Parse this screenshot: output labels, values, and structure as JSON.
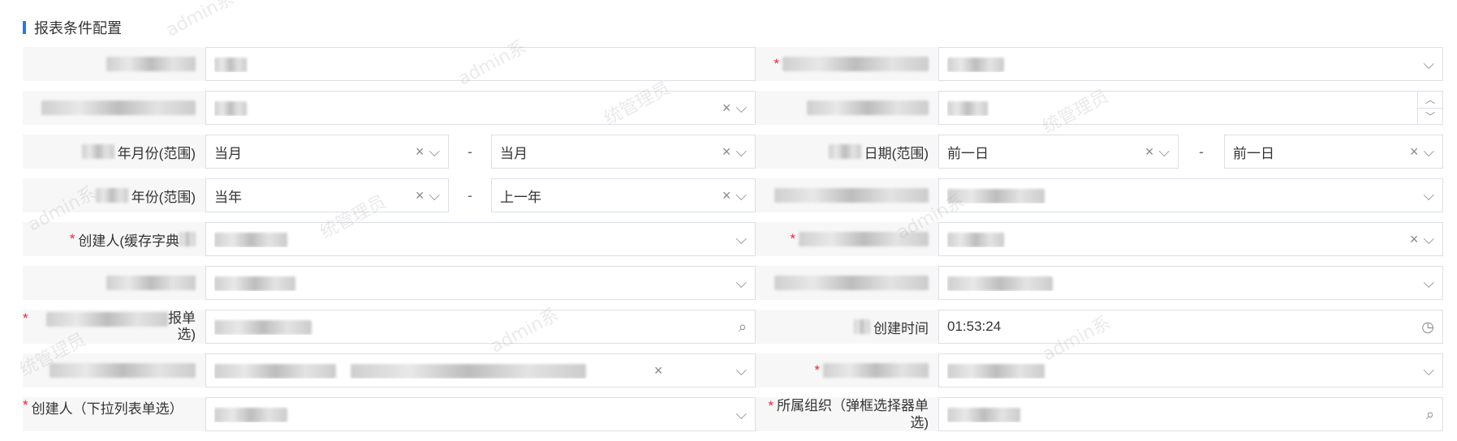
{
  "section": {
    "title": "报表条件配置"
  },
  "watermark": [
    "admin系",
    "统管理员"
  ],
  "rows": {
    "r1": {
      "right_required": "*"
    },
    "r2": {
      "left_label_prefix": "*字典状态(数据字典单选)",
      "right_label": "年份"
    },
    "r3": {
      "left_label": "年月份(范围)",
      "left_from": "当月",
      "left_to": "当月",
      "dash": "-",
      "right_label": "日期(范围)",
      "right_from": "前一日",
      "right_to": "前一日"
    },
    "r4": {
      "left_label": "年份(范围)",
      "left_from": "当年",
      "left_to": "上一年",
      "dash": "-"
    },
    "r5": {
      "left_label_prefix": "创建人(缓存字典",
      "left_required": "*",
      "right_required": "*"
    },
    "r7": {
      "left_required": "*",
      "left_label_tail": "选)",
      "left_label_tail2": "报单",
      "right_label": "创建时间",
      "right_value": "01:53:24"
    },
    "r8": {
      "right_required": "*"
    },
    "r9": {
      "left_required": "*",
      "left_label": "创建人（下拉列表单选）",
      "right_required": "*",
      "right_label": "所属组织（弹框选择器单",
      "right_label_tail": "选)"
    }
  },
  "icons": {
    "clear": "×",
    "chevron": "⌵",
    "search": "⌕",
    "clock": "◷",
    "up": "︿",
    "down": "﹀"
  },
  "colors": {
    "accent": "#1f7bf0",
    "required": "#f5222d",
    "border": "#dcdfe6",
    "label_bg": "#f7f7f7"
  }
}
